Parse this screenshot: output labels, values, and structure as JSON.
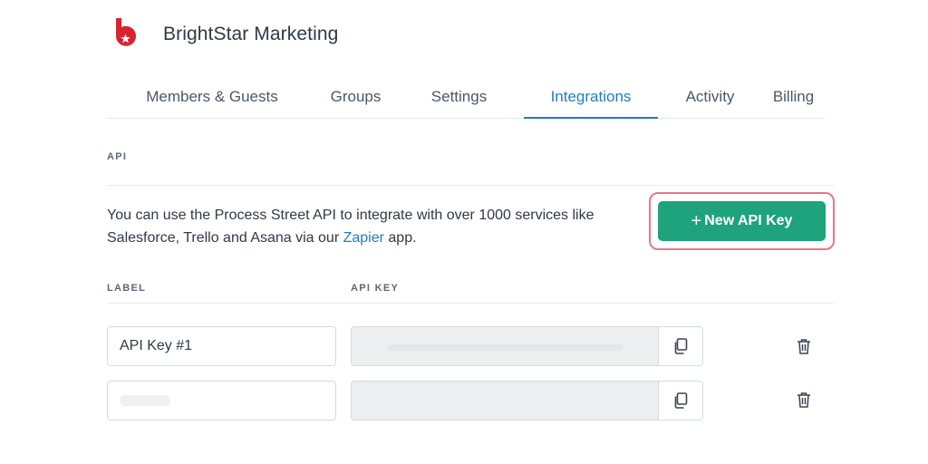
{
  "org": {
    "name": "BrightStar Marketing",
    "logo_color": "#d9232e"
  },
  "tabs": [
    {
      "label": "Members & Guests",
      "active": false
    },
    {
      "label": "Groups",
      "active": false
    },
    {
      "label": "Settings",
      "active": false
    },
    {
      "label": "Integrations",
      "active": true
    },
    {
      "label": "Activity",
      "active": false
    },
    {
      "label": "Billing",
      "active": false
    }
  ],
  "api_section": {
    "heading": "API",
    "description_before": "You can use the Process Street API to integrate with over 1000 services like Salesforce, Trello and Asana via our ",
    "description_link": "Zapier",
    "description_after": " app.",
    "new_key_button": "New API Key",
    "new_key_button_icon": "plus-icon",
    "accent_color": "#1ea37c",
    "highlight_color": "#e5798b"
  },
  "table": {
    "headers": {
      "label": "LABEL",
      "api_key": "API KEY"
    },
    "rows": [
      {
        "label": "API Key #1",
        "api_key": ""
      },
      {
        "label": "",
        "api_key": ""
      }
    ]
  }
}
